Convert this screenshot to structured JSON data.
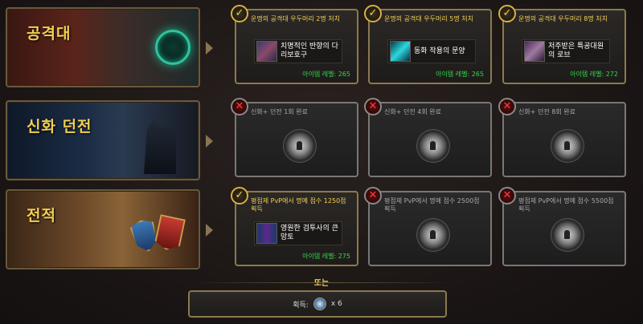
{
  "rows": [
    {
      "title": "공격대",
      "cards": [
        {
          "status": "complete",
          "req": "운명의 공격대 우두머리 2명 처치",
          "item_name": "치명적인 반향의 다리보호구",
          "ilvl": "아이템 레벨: 265",
          "icon": "armor-leggings-icon"
        },
        {
          "status": "complete",
          "req": "운명의 공격대 우두머리 5명 처치",
          "item_name": "동화 작용의 문양",
          "ilvl": "아이템 레벨: 265",
          "icon": "rune-glyph-icon"
        },
        {
          "status": "complete",
          "req": "운명의 공격대 우두머리 8명 처치",
          "item_name": "저주받은 특공대원의 로브",
          "ilvl": "아이템 레벨: 272",
          "icon": "robe-icon"
        }
      ]
    },
    {
      "title": "신화 던전",
      "cards": [
        {
          "status": "locked",
          "req": "신화+ 던전 1회 완료"
        },
        {
          "status": "locked",
          "req": "신화+ 던전 4회 완료"
        },
        {
          "status": "locked",
          "req": "신화+ 던전 8회 완료"
        }
      ]
    },
    {
      "title": "전적",
      "cards": [
        {
          "status": "complete",
          "req": "평점제 PvP에서 명예 점수 1250점 획득",
          "item_name": "영원한 검투사의 큰망토",
          "ilvl": "아이템 레벨: 275",
          "icon": "cloak-icon"
        },
        {
          "status": "locked",
          "req": "평점제 PvP에서 명예 점수 2500점 획득"
        },
        {
          "status": "locked",
          "req": "평점제 PvP에서 명예 점수 5500점 획득"
        }
      ]
    }
  ],
  "or_label": "또는",
  "obtain": {
    "label": "획득:",
    "quantity": "x 6",
    "icon": "valor-token-icon"
  },
  "colors": {
    "accent_gold": "#f2cf52",
    "ilvl_green": "#34d84a",
    "border_gold": "#8c7a4c"
  }
}
